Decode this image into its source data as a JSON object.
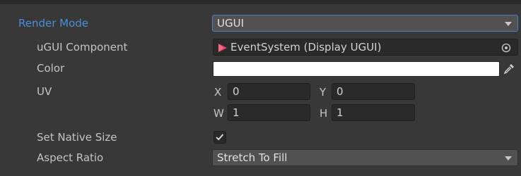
{
  "render_mode": {
    "label": "Render Mode",
    "value": "UGUI"
  },
  "ugui_component": {
    "label": "uGUI Component",
    "value": "EventSystem (Display UGUI)",
    "icon": "ugui-component-icon",
    "icon_color": "#e8466a"
  },
  "color": {
    "label": "Color",
    "value": "#ffffff"
  },
  "uv": {
    "label": "UV",
    "x_label": "X",
    "x_value": "0",
    "y_label": "Y",
    "y_value": "0",
    "w_label": "W",
    "w_value": "1",
    "h_label": "H",
    "h_value": "1"
  },
  "set_native_size": {
    "label": "Set Native Size",
    "checked": true
  },
  "aspect_ratio": {
    "label": "Aspect Ratio",
    "value": "Stretch To Fill"
  },
  "colors": {
    "background": "#383838",
    "highlight_label": "#4c8fd6",
    "field_bg": "#2a2a2a",
    "dropdown_bg": "#515151",
    "focus_border": "#4e7fc5"
  }
}
